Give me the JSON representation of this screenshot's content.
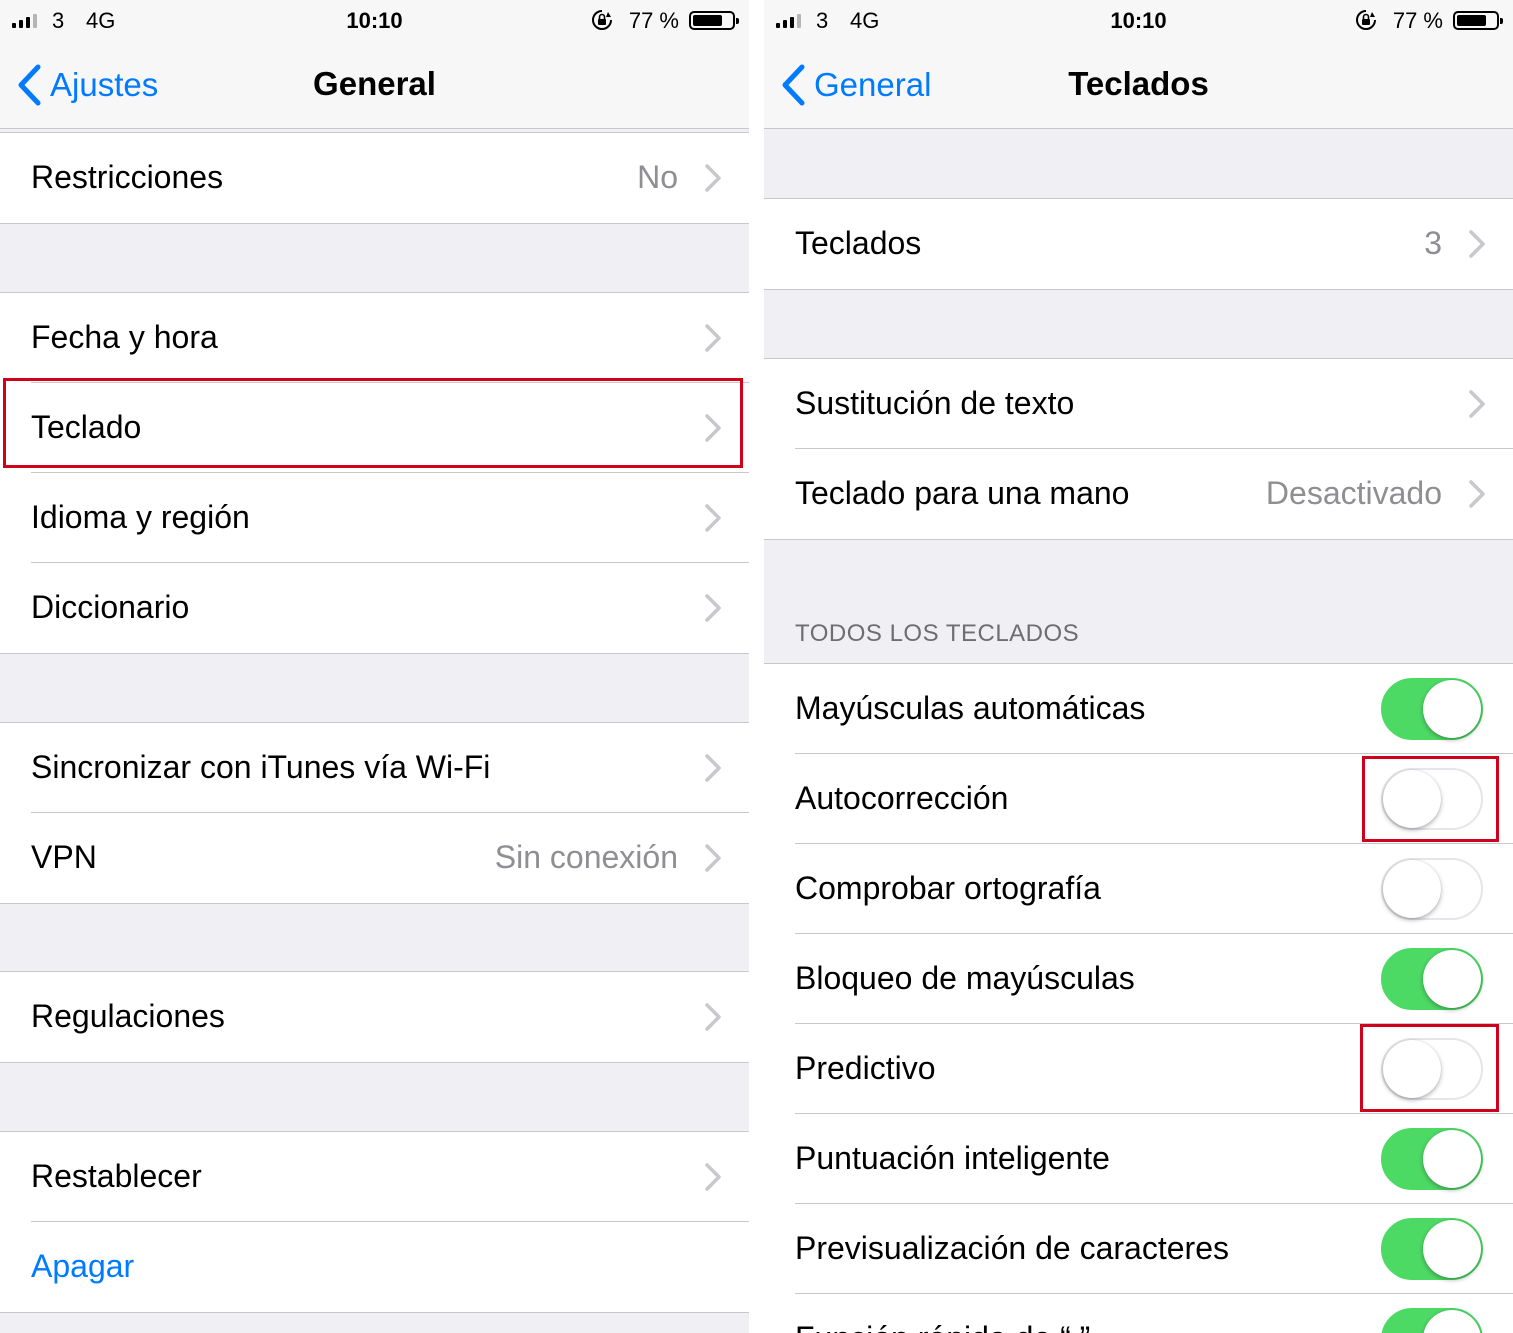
{
  "status_bar": {
    "carrier": "3",
    "network": "4G",
    "time": "10:10",
    "battery_percent": "77 %",
    "battery_level": 0.77
  },
  "left": {
    "nav": {
      "back_label": "Ajustes",
      "title": "General"
    },
    "groups": [
      {
        "rows": [
          {
            "label": "Restricciones",
            "value": "No"
          }
        ]
      },
      {
        "rows": [
          {
            "label": "Fecha y hora"
          },
          {
            "label": "Teclado",
            "highlighted": true
          },
          {
            "label": "Idioma y región"
          },
          {
            "label": "Diccionario"
          }
        ]
      },
      {
        "rows": [
          {
            "label": "Sincronizar con iTunes vía Wi-Fi"
          },
          {
            "label": "VPN",
            "value": "Sin conexión"
          }
        ]
      },
      {
        "rows": [
          {
            "label": "Regulaciones"
          }
        ]
      },
      {
        "rows": [
          {
            "label": "Restablecer"
          },
          {
            "label": "Apagar",
            "style": "link"
          }
        ]
      }
    ]
  },
  "right": {
    "nav": {
      "back_label": "General",
      "title": "Teclados"
    },
    "groups": [
      {
        "rows": [
          {
            "label": "Teclados",
            "value": "3"
          }
        ]
      },
      {
        "rows": [
          {
            "label": "Sustitución de texto"
          },
          {
            "label": "Teclado para una mano",
            "value": "Desactivado"
          }
        ]
      }
    ],
    "section_header": "TODOS LOS TECLADOS",
    "toggles": [
      {
        "label": "Mayúsculas automáticas",
        "on": true
      },
      {
        "label": "Autocorrección",
        "on": false,
        "highlighted": true
      },
      {
        "label": "Comprobar ortografía",
        "on": false
      },
      {
        "label": "Bloqueo de mayúsculas",
        "on": true
      },
      {
        "label": "Predictivo",
        "on": false,
        "highlighted": true
      },
      {
        "label": "Puntuación inteligente",
        "on": true
      },
      {
        "label": "Previsualización de caracteres",
        "on": true
      },
      {
        "label": "Función rápida de “.”",
        "on": true
      }
    ]
  },
  "colors": {
    "accent": "#007aff",
    "switch_on": "#4cd964",
    "highlight": "#d0021b",
    "grouped_background": "#efeff4"
  }
}
